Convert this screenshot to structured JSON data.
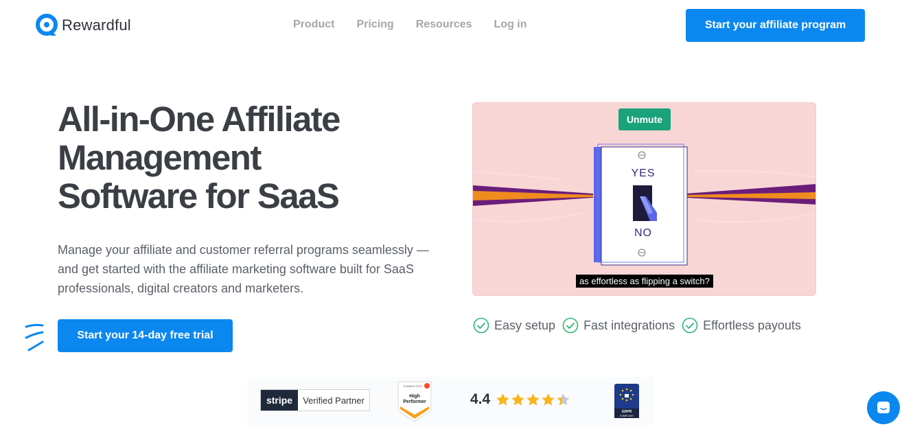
{
  "brand": {
    "name": "Rewardful"
  },
  "nav": {
    "items": [
      "Product",
      "Pricing",
      "Resources",
      "Log in"
    ]
  },
  "header": {
    "cta_label": "Start your affiliate program"
  },
  "hero": {
    "headline_lines": [
      "All-in-One Affiliate",
      "Management",
      "Software for SaaS"
    ],
    "subtext": "Manage your affiliate and customer referral programs seamlessly — and get started with the affiliate marketing software built for SaaS professionals, digital creators and marketers.",
    "cta_label": "Start your 14-day free trial"
  },
  "video": {
    "unmute_label": "Unmute",
    "switch_top": "YES",
    "switch_bottom": "NO",
    "caption": "as effortless as flipping a switch?"
  },
  "features": [
    "Easy setup",
    "Fast integrations",
    "Effortless payouts"
  ],
  "trust": {
    "stripe_word": "stripe",
    "stripe_label": "Verified Partner",
    "g2_season": "SUMMER 2025",
    "g2_line1": "High",
    "g2_line2": "Performer",
    "rating": "4.4",
    "rating_stars": 4.4,
    "gdpr_line1": "GDPR",
    "gdpr_line2": "COMPLIANT"
  },
  "colors": {
    "accent": "#0b87f0",
    "check": "#2bb673",
    "unmute": "#1aa37a",
    "star": "#f7b51d"
  }
}
